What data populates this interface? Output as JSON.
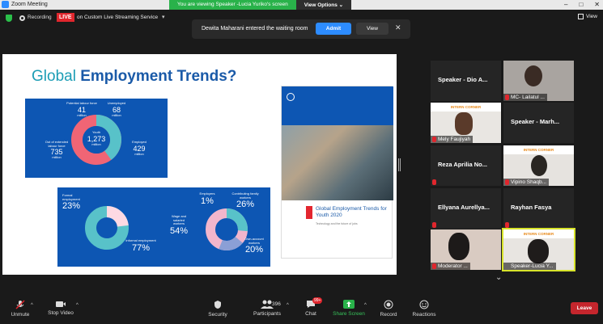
{
  "window": {
    "title": "Zoom Meeting",
    "controls": [
      "–",
      "□",
      "✕"
    ]
  },
  "share": {
    "notice": "You are viewing Speaker -Lucia Yuriko's screen",
    "view_options": "View Options ⌄"
  },
  "topbar": {
    "recording": "Recording",
    "live_badge": "LIVE",
    "live_text": "on Custom Live Streaming Service",
    "caret": "▾",
    "view_label": "View"
  },
  "waiting": {
    "message": "Dewita Maharani entered the waiting room",
    "admit": "Admit",
    "view": "View",
    "close": "✕"
  },
  "slide": {
    "title_prefix": "Global ",
    "title_bold": "Employment Trends?",
    "panel1": [
      {
        "label": "Potential labour force",
        "value": "41",
        "unit": "million"
      },
      {
        "label": "Unemployed",
        "value": "68",
        "unit": "million"
      },
      {
        "label": "Out of extended labour force",
        "value": "735",
        "unit": "million"
      },
      {
        "label": "Youth",
        "value": "1,273",
        "unit": "million"
      },
      {
        "label": "Employed",
        "value": "429",
        "unit": "million"
      }
    ],
    "panel2": [
      {
        "label": "Formal employment",
        "value": "23%"
      },
      {
        "label": "Informal employment",
        "value": "77%"
      },
      {
        "label": "Employers",
        "value": "1%"
      },
      {
        "label": "Contributing family workers",
        "value": "26%"
      },
      {
        "label": "Wage and salaried workers",
        "value": "54%"
      },
      {
        "label": "Own-account workers",
        "value": "20%"
      }
    ],
    "cover_title": "Global Employment Trends for Youth 2020",
    "cover_sub": "Technology and the future of jobs"
  },
  "participants": [
    {
      "name": "Speaker - Dio A...",
      "type": "name"
    },
    {
      "name": "MC- Lailatul ...",
      "type": "video"
    },
    {
      "name": "Mely Faujiyah",
      "type": "video",
      "banner": "INTERN CORNER"
    },
    {
      "name": "Speaker - Marh...",
      "type": "name"
    },
    {
      "name": "Reza Aprilia No...",
      "type": "name"
    },
    {
      "name": "Vipino Shaqb...",
      "type": "video",
      "banner": "INTERN CORNER"
    },
    {
      "name": "Ellyana Aurellya...",
      "type": "name"
    },
    {
      "name": "Rayhan Fasya",
      "type": "name"
    },
    {
      "name": "Moderator ...",
      "type": "video"
    },
    {
      "name": "Speaker-Lucia Y...",
      "type": "video",
      "banner": "INTERN CORNER"
    }
  ],
  "toolbar": {
    "unmute": "Unmute",
    "stop_video": "Stop Video",
    "security": "Security",
    "participants": "Participants",
    "participants_count": "396",
    "chat": "Chat",
    "chat_badge": "99+",
    "share_screen": "Share Screen",
    "record": "Record",
    "reactions": "Reactions",
    "leave": "Leave"
  },
  "colors": {
    "accent": "#2d8cff",
    "share_green": "#29b24a",
    "live_red": "#e0262d",
    "slide_blue": "#0d56b3"
  }
}
